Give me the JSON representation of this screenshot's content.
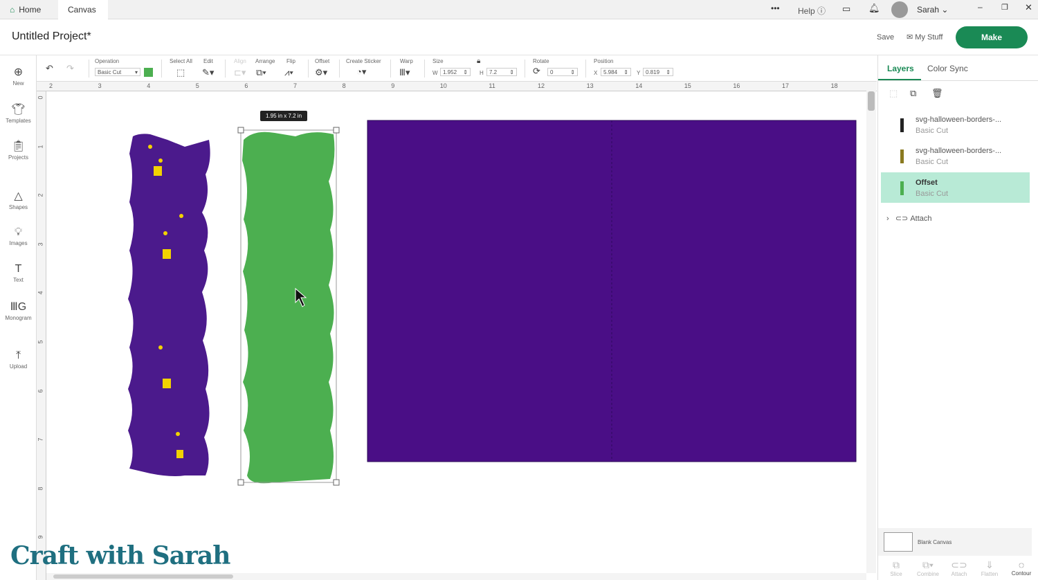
{
  "tabs": [
    {
      "label": "Home"
    },
    {
      "label": "Canvas"
    }
  ],
  "topbar": {
    "more": "•••",
    "help": "Help",
    "user": "Sarah"
  },
  "header": {
    "title": "Untitled Project*",
    "save": "Save",
    "my_stuff": "My Stuff",
    "make": "Make"
  },
  "sidebar": [
    {
      "label": "New",
      "icon": "plus-circle-icon"
    },
    {
      "label": "Templates",
      "icon": "shirt-icon"
    },
    {
      "label": "Projects",
      "icon": "clipboard-icon"
    },
    {
      "label": "Shapes",
      "icon": "shapes-icon"
    },
    {
      "label": "Images",
      "icon": "bulb-icon"
    },
    {
      "label": "Text",
      "icon": "text-icon"
    },
    {
      "label": "Monogram",
      "icon": "monogram-icon"
    },
    {
      "label": "Upload",
      "icon": "upload-icon"
    }
  ],
  "toolbar": {
    "operation_label": "Operation",
    "operation_value": "Basic Cut",
    "operation_color": "#4caf50",
    "select_all": "Select All",
    "edit": "Edit",
    "align": "Align",
    "arrange": "Arrange",
    "flip": "Flip",
    "offset": "Offset",
    "create_sticker": "Create Sticker",
    "warp": "Warp",
    "size": "Size",
    "w_label": "W",
    "w": "1.952",
    "h_label": "H",
    "h": "7.2",
    "rotate": "Rotate",
    "rotate_value": "0",
    "position": "Position",
    "x_label": "X",
    "x": "5.984",
    "y_label": "Y",
    "y": "0.819"
  },
  "ruler": {
    "h": [
      "2",
      "3",
      "4",
      "5",
      "6",
      "7",
      "8",
      "9",
      "10",
      "11",
      "12",
      "13",
      "14",
      "15",
      "16",
      "17",
      "18"
    ],
    "v": [
      "0",
      "1",
      "2",
      "3",
      "4",
      "5",
      "6",
      "7",
      "8",
      "9"
    ]
  },
  "canvas": {
    "size_tooltip": "1.95  in x 7.2  in",
    "colors": {
      "purple": "#4b1a8c",
      "green": "#4caf50",
      "rect": "#4a0e86"
    },
    "watermark": "Craft with Sarah"
  },
  "panel": {
    "tabs": [
      "Layers",
      "Color Sync"
    ],
    "layers": [
      {
        "name": "svg-halloween-borders-...",
        "op": "Basic Cut"
      },
      {
        "name": "svg-halloween-borders-...",
        "op": "Basic Cut"
      },
      {
        "name": "Offset",
        "op": "Basic Cut"
      }
    ],
    "attach": "Attach",
    "blank_canvas": "Blank Canvas",
    "bottom": [
      "Slice",
      "Combine",
      "Attach",
      "Flatten",
      "Contour"
    ]
  }
}
